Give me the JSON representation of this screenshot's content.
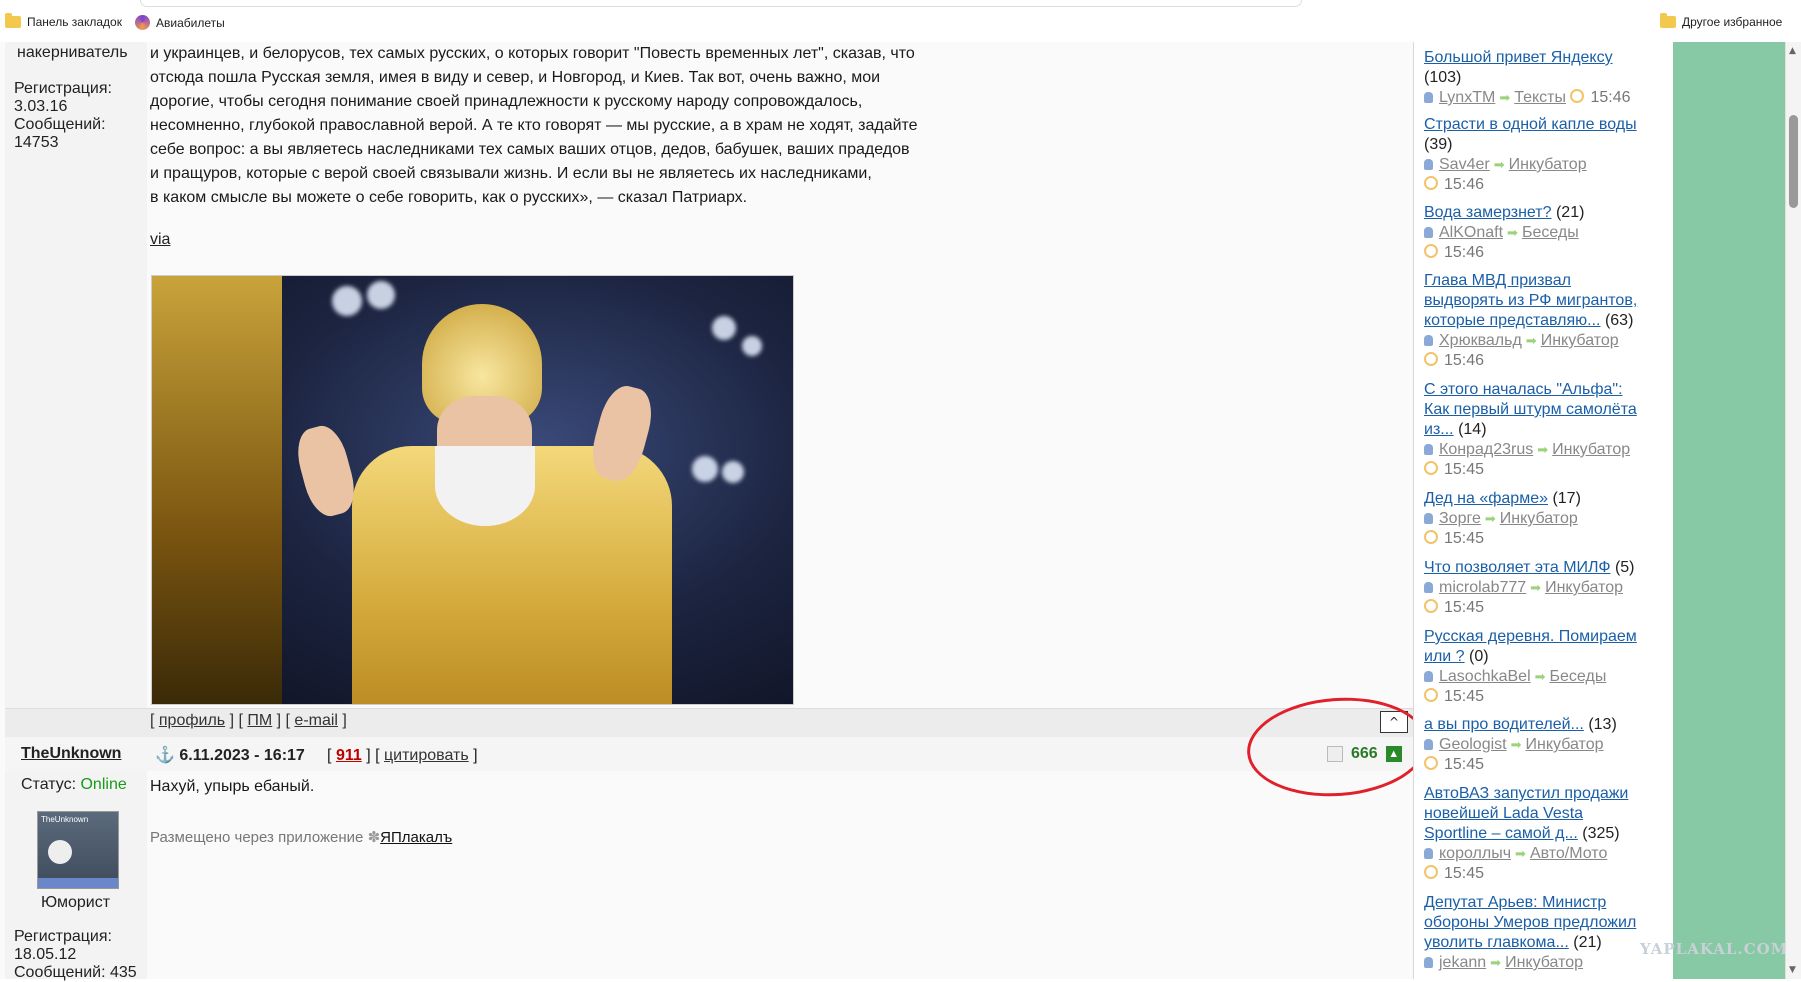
{
  "bookmarks": {
    "left1": "Панель закладок",
    "left2": "Авиабилеты",
    "right": "Другое избранное"
  },
  "post1": {
    "author_fragment": "накерниватель",
    "reg_label": "Регистрация:",
    "reg_date": "3.03.16",
    "msgs_label": "Сообщений:",
    "msgs_count": "14753",
    "paragraph_lines": [
      "и украинцев, и белорусов, тех самых русских, о которых говорит \"Повесть временных лет\", сказав, что",
      "отсюда пошла Русская земля, имея в виду и север, и Новгород, и Киев. Так вот, очень важно, мои",
      "дорогие, чтобы сегодня понимание своей принадлежности к русскому народу сопровождалось,",
      "несомненно, глубокой православной верой. А те кто говорят — мы русские, а в храм не ходят, задайте",
      "себе вопрос: а вы являетесь наследниками тех самых ваших отцов, дедов, бабушек, ваших прадедов",
      "и пращуров, которые с верой своей связывали жизнь. И если вы не являетесь их наследниками,",
      "в каком смысле вы можете о себе говорить, как о русских», — сказал Патриарх."
    ],
    "via": "via",
    "links": [
      "профиль",
      "ПМ",
      "e-mail"
    ],
    "up_button": "^"
  },
  "post2": {
    "author": "TheUnknown",
    "date": "6.11.2023 - 16:17",
    "post_number": "911",
    "quote": "цитировать",
    "rating": "666",
    "status_label": "Статус:",
    "status_value": "Online",
    "avatar_text": "TheUnknown",
    "rank": "Юморист",
    "reg_label": "Регистрация:",
    "reg_date": "18.05.12",
    "msgs": "Сообщений: 435",
    "text": "Нахуй, упырь ебаный.",
    "via_prefix": "Размещено через приложение",
    "via_app": "ЯПлакалъ"
  },
  "sidebar": {
    "topics": [
      {
        "title_lines": [
          "Большой привет Яндексу"
        ],
        "count": "(103)",
        "user": "LynxTM",
        "category": "Тексты",
        "time": "15:46",
        "time_inline": true
      },
      {
        "title_lines": [
          "Страсти в одной капле воды"
        ],
        "count": "(39)",
        "user": "Sav4er",
        "category": "Инкубатор",
        "time": "15:46",
        "time_inline": false
      },
      {
        "title_lines": [
          "Вода замерзнет?"
        ],
        "count": "(21)",
        "user": "AlKOnaft",
        "category": "Беседы",
        "time": "15:46",
        "time_inline": false
      },
      {
        "title_lines": [
          "Глава МВД призвал",
          "выдворять из РФ мигрантов,",
          "которые представляю..."
        ],
        "count": "(63)",
        "user": "Хрюквальд",
        "category": "Инкубатор",
        "time": "15:46",
        "time_inline": false
      },
      {
        "title_lines": [
          "С этого началась \"Альфа\":",
          "Как первый штурм самолёта",
          "из..."
        ],
        "count": "(14)",
        "user": "Конрад23rus",
        "category": "Инкубатор",
        "time": "15:45",
        "time_inline": false
      },
      {
        "title_lines": [
          "Дед на «фарме»"
        ],
        "count": "(17)",
        "user": "Зорге",
        "category": "Инкубатор",
        "time": "15:45",
        "time_inline": false
      },
      {
        "title_lines": [
          "Что позволяет эта МИЛФ"
        ],
        "count": "(5)",
        "user": "microlab777",
        "category": "Инкубатор",
        "time": "15:45",
        "time_inline": false
      },
      {
        "title_lines": [
          "Русская деревня. Помираем",
          "или ?"
        ],
        "count": "(0)",
        "user": "LasochkaBel",
        "category": "Беседы",
        "time": "15:45",
        "time_inline": false
      },
      {
        "title_lines": [
          "а вы про водителей..."
        ],
        "count": "(13)",
        "user": "Geologist",
        "category": "Инкубатор",
        "time": "15:45",
        "time_inline": false
      },
      {
        "title_lines": [
          "АвтоВАЗ запустил продажи",
          "новейшей Lada Vesta",
          "Sportline – самой д..."
        ],
        "count": "(325)",
        "user": "короллыч",
        "category": "Авто/Мото",
        "time": "15:45",
        "time_inline": false
      },
      {
        "title_lines": [
          "Депутат Арьев: Министр",
          "обороны Умеров предложил",
          "уволить главкома..."
        ],
        "count": "(21)",
        "user": "jekann",
        "category": "Инкубатор",
        "time": "",
        "time_inline": false
      }
    ]
  },
  "watermark": "YAPLAKAL.COM",
  "colors": {
    "link": "#1a5fa8",
    "online": "#1a9a1a",
    "rating": "#2a7a2a",
    "highlight": "#e0202a",
    "green_strip": "#86c9a4"
  }
}
